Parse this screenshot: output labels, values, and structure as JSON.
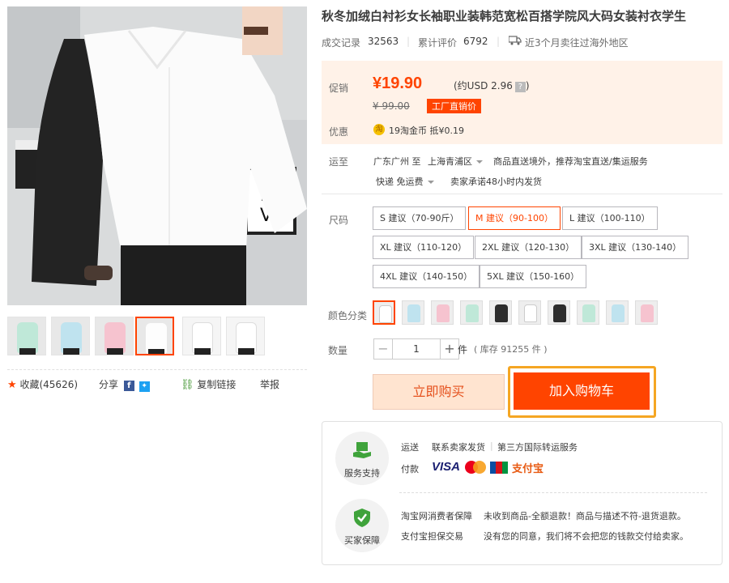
{
  "product": {
    "title": "秋冬加绒白衬衫女长袖职业装韩范宽松百搭学院风大码女装衬衣学生"
  },
  "stats": {
    "deals_label": "成交记录",
    "deals_value": "32563",
    "reviews_label": "累计评价",
    "reviews_value": "6792",
    "shipping_note": "近3个月卖往过海外地区"
  },
  "price": {
    "promo_label": "促销",
    "current": "¥19.90",
    "usd": "(约USD 2.96",
    "usd_help": "?",
    "usd_close": ")",
    "original": "¥ 99.00",
    "factory_tag": "工厂直销价",
    "benefit_label": "优惠",
    "coin_icon_text": "淘",
    "coin_text": "19淘金币 抵¥0.19"
  },
  "shipping": {
    "label": "运至",
    "from": "广东广州 至",
    "to": "上海青浦区",
    "service": "商品直送境外，推荐淘宝直送/集运服务",
    "express": "快递 免运费",
    "promise": "卖家承诺48小时内发货"
  },
  "sizes": {
    "label": "尺码",
    "options": [
      "S 建议（70-90斤）",
      "M 建议（90-100）",
      "L 建议（100-110）",
      "XL 建议（110-120）",
      "2XL 建议（120-130）",
      "3XL 建议（130-140）",
      "4XL 建议（140-150）",
      "5XL 建议（150-160）"
    ],
    "selected": "M 建议（90-100）"
  },
  "colors": {
    "label": "颜色分类",
    "swatches": [
      "#ffffff",
      "#bfe3ef",
      "#f6c3cf",
      "#bfe8d8",
      "#2d2d2d",
      "#ffffff",
      "#2d2d2d",
      "#bfe8d8",
      "#bfe3ef",
      "#f6c3cf"
    ]
  },
  "quantity": {
    "label": "数量",
    "minus": "−",
    "value": "1",
    "plus": "+",
    "unit": "件",
    "stock": "( 库存 91255 件 )"
  },
  "actions": {
    "buy_now": "立即购买",
    "add_to_cart": "加入购物车"
  },
  "social": {
    "favorite": "收藏(45626)",
    "share": "分享",
    "facebook": "f",
    "copy_link": "复制链接",
    "report": "举报"
  },
  "service": {
    "support_caption": "服务支持",
    "protect_caption": "买家保障",
    "delivery_label": "运送",
    "delivery_value": "联系卖家发货",
    "delivery_sep": "|",
    "delivery_value2": "第三方国际转运服务",
    "payment_label": "付款",
    "visa": "VISA",
    "alipay": "支付宝",
    "guarantee1_label": "淘宝网消费者保障",
    "guarantee1_text": "未收到商品-全额退款！商品与描述不符-退货退款。",
    "guarantee2_label": "支付宝担保交易",
    "guarantee2_text": "没有您的同意，我们将不会把您的钱款交付给卖家。"
  },
  "colors_theme": {
    "accent": "#ff4400",
    "price_bg": "#fff2e8",
    "highlight_frame": "#f5a623"
  }
}
